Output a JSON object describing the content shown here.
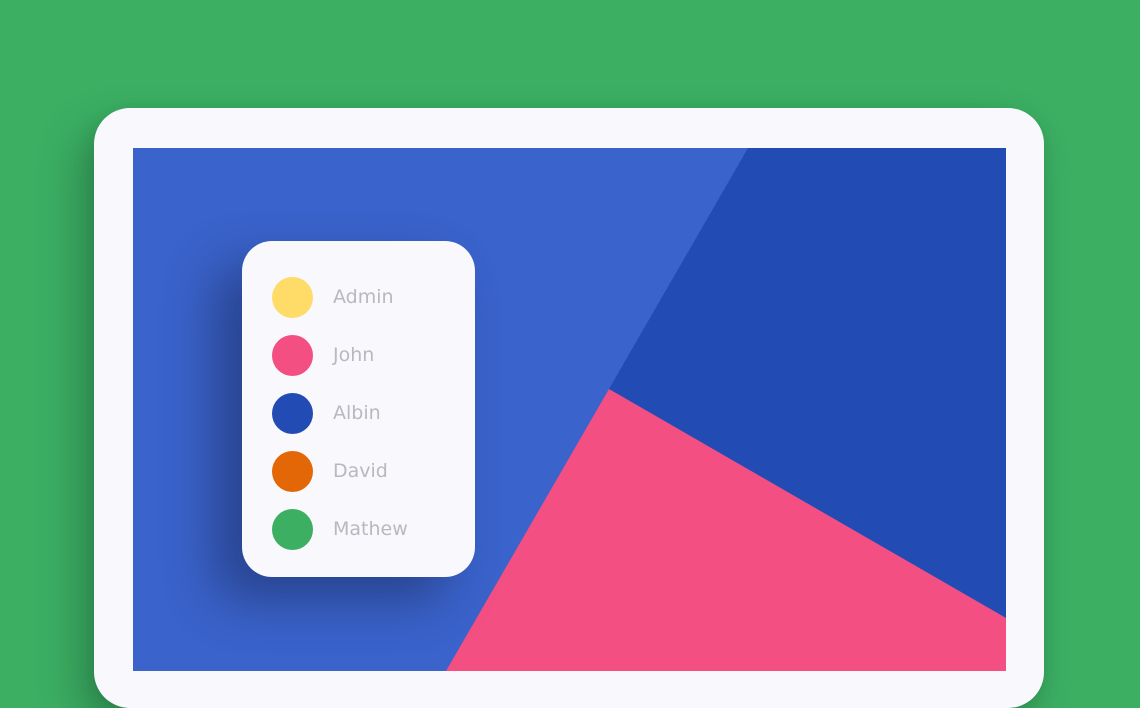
{
  "legend": {
    "items": [
      {
        "label": "Admin",
        "color": "#ffdb67"
      },
      {
        "label": "John",
        "color": "#f34f83"
      },
      {
        "label": "Albin",
        "color": "#234bb4"
      },
      {
        "label": "David",
        "color": "#e36607"
      },
      {
        "label": "Mathew",
        "color": "#3caf63"
      }
    ]
  },
  "chart": {
    "colors": {
      "background": "#3a63cb",
      "dark_blue": "#234bb4",
      "pink": "#f34f83"
    }
  }
}
